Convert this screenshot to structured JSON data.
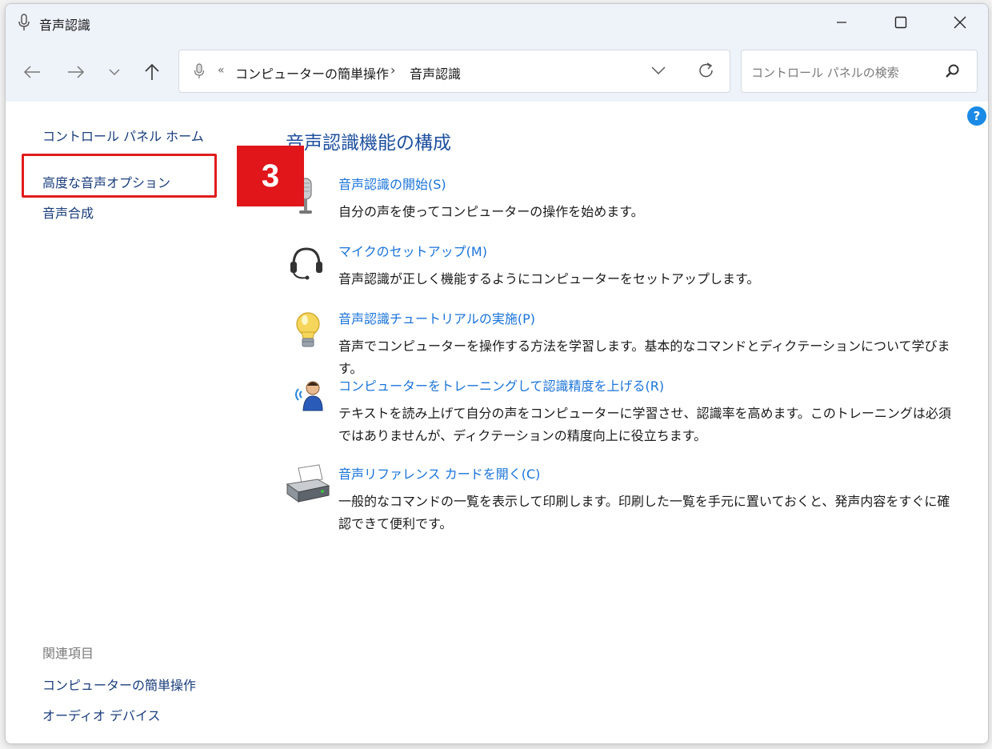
{
  "window": {
    "title": "音声認識",
    "icons": {
      "app": "microphone-icon",
      "minimize": "minimize-icon",
      "maximize": "maximize-icon",
      "close": "close-icon"
    }
  },
  "nav": {
    "back_icon": "back-arrow-icon",
    "forward_icon": "forward-arrow-icon",
    "recent_icon": "chevron-down-icon",
    "up_icon": "up-arrow-icon"
  },
  "address": {
    "overflow": "«",
    "crumbs": [
      "コンピューターの簡単操作",
      "音声認識"
    ],
    "separator": "›"
  },
  "search": {
    "placeholder": "コントロール パネルの検索"
  },
  "sidebar": {
    "home": "コントロール パネル ホーム",
    "items": [
      "高度な音声オプション",
      "音声合成"
    ],
    "related_heading": "関連項目",
    "related": [
      "コンピューターの簡単操作",
      "オーディオ デバイス"
    ]
  },
  "annotation": {
    "step": "3",
    "highlight_color": "#e01c1c",
    "badge_color": "#e0161b"
  },
  "main": {
    "title": "音声認識機能の構成",
    "tasks": [
      {
        "icon": "microphone-icon",
        "link": "音声認識の開始(S)",
        "desc": "自分の声を使ってコンピューターの操作を始めます。"
      },
      {
        "icon": "headset-icon",
        "link": "マイクのセットアップ(M)",
        "desc": "音声認識が正しく機能するようにコンピューターをセットアップします。"
      },
      {
        "icon": "lightbulb-icon",
        "link": "音声認識チュートリアルの実施(P)",
        "desc": "音声でコンピューターを操作する方法を学習します。基本的なコマンドとディクテーションについて学びます。"
      },
      {
        "icon": "speaking-person-icon",
        "link": "コンピューターをトレーニングして認識精度を上げる(R)",
        "desc": "テキストを読み上げて自分の声をコンピューターに学習させ、認識率を高めます。このトレーニングは必須ではありませんが、ディクテーションの精度向上に役立ちます。"
      },
      {
        "icon": "printer-icon",
        "link": "音声リファレンス カードを開く(C)",
        "desc": "一般的なコマンドの一覧を表示して印刷します。印刷した一覧を手元に置いておくと、発声内容をすぐに確認できて便利です。"
      }
    ]
  },
  "colors": {
    "link": "#1a73d9",
    "title": "#1e4f9e",
    "help": "#1a8ae6"
  }
}
